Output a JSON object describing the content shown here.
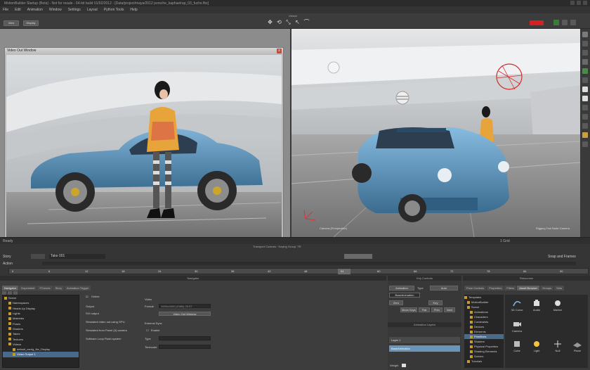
{
  "window": {
    "title": "MotionBuilder Startup (Beta) - Not for resale - 64-bit build 01/02/2012 - [Data/project/maya/2012 porsche_kaphaelrap_03_fuchs.fbx]"
  },
  "menu": [
    "File",
    "Edit",
    "Animation",
    "Window",
    "Settings",
    "Layout",
    "Python Tools",
    "Help"
  ],
  "toolbar": {
    "left_buttons": [
      "View",
      "Display"
    ],
    "center_label": "Viewer"
  },
  "video_window": {
    "title": "Video Out Window",
    "close": "x"
  },
  "viewport": {
    "camera_label": "Camera (Perspective)",
    "right_label": "Rigging Tool Node Camera"
  },
  "status": {
    "left": "Ready",
    "right": "1 Grid"
  },
  "timeline": {
    "title": "Transport Controls · Keying Group: TR",
    "row1_left": "Story",
    "row1_field": "Take 001",
    "row1_right": "Snap and Frames",
    "row2_left": "Action",
    "ticks": [
      "0",
      "6",
      "12",
      "18",
      "24",
      "30",
      "36",
      "42",
      "48",
      "54",
      "60",
      "66",
      "72",
      "78",
      "84",
      "90"
    ]
  },
  "navigator": {
    "header": "Navigator",
    "tabs": [
      "Navigator",
      "Dopesheet",
      "FCurves",
      "Story",
      "Animation Trigger"
    ],
    "active_tab": "Navigator",
    "tree": [
      {
        "label": "Scene",
        "indent": 0,
        "selected": false
      },
      {
        "label": "Namespaces",
        "indent": 1,
        "selected": false
      },
      {
        "label": "Heads Up Display",
        "indent": 1,
        "selected": false
      },
      {
        "label": "Lights",
        "indent": 1,
        "selected": false
      },
      {
        "label": "Materials",
        "indent": 1,
        "selected": false
      },
      {
        "label": "Poses",
        "indent": 1,
        "selected": false
      },
      {
        "label": "Shaders",
        "indent": 1,
        "selected": false
      },
      {
        "label": "Takes",
        "indent": 1,
        "selected": false
      },
      {
        "label": "Textures",
        "indent": 1,
        "selected": false
      },
      {
        "label": "Videos",
        "indent": 1,
        "selected": false
      },
      {
        "label": "default_carrig_fbx_Display",
        "indent": 2,
        "selected": false
      },
      {
        "label": "Video Output 1",
        "indent": 2,
        "selected": true
      }
    ]
  },
  "properties": {
    "online_label": "Online",
    "output_label": "Output",
    "items": [
      "SVI output",
      "Simulated video out using GPU",
      "Simulated from Panel (3) camera",
      "Software Loop Flash system"
    ],
    "video_label": "Video",
    "format_label": "Format",
    "format_value": "1920x1080 (1080i) 29.97",
    "video_out_button": "Video Out Window",
    "external_sync_label": "External Sync",
    "enable_label": "Enable",
    "type_label": "Type",
    "timecode_label": "Timecode"
  },
  "key_controls": {
    "header": "Key Controls",
    "animation_btn": "Animation",
    "type_label": "Type",
    "type_value": "Auto",
    "base_anim": "BaseAnimation",
    "buttons": [
      "Zero",
      "Key",
      "Move Keys",
      "Flat",
      "Prev",
      "Next"
    ],
    "animation_layers_header": "Animation Layers",
    "layers": [
      {
        "name": "Layer 1",
        "active": false
      },
      {
        "name": "BaseAnimation",
        "active": true
      }
    ],
    "weight_label": "Weight"
  },
  "resources": {
    "header": "Resources",
    "tabs": [
      "Pose Controls",
      "Properties",
      "Filters",
      "Asset Browser",
      "Groups",
      "Sets"
    ],
    "active_tab": "Asset Browser",
    "tree": [
      "Templates",
      "MotionBuilder",
      "Scene",
      "Animations",
      "Characters",
      "Constraints",
      "Devices",
      "Elements",
      "Primitives",
      "Shaders",
      "Physical Properties",
      "Shading Elements",
      "Solvers",
      "Tutorials"
    ],
    "grid": [
      {
        "label": "3D Curve"
      },
      {
        "label": "Audio"
      },
      {
        "label": "Camera"
      },
      {
        "label": "Cube"
      },
      {
        "label": "Light"
      },
      {
        "label": "Marker"
      },
      {
        "label": "Null"
      },
      {
        "label": "Plane"
      }
    ]
  }
}
